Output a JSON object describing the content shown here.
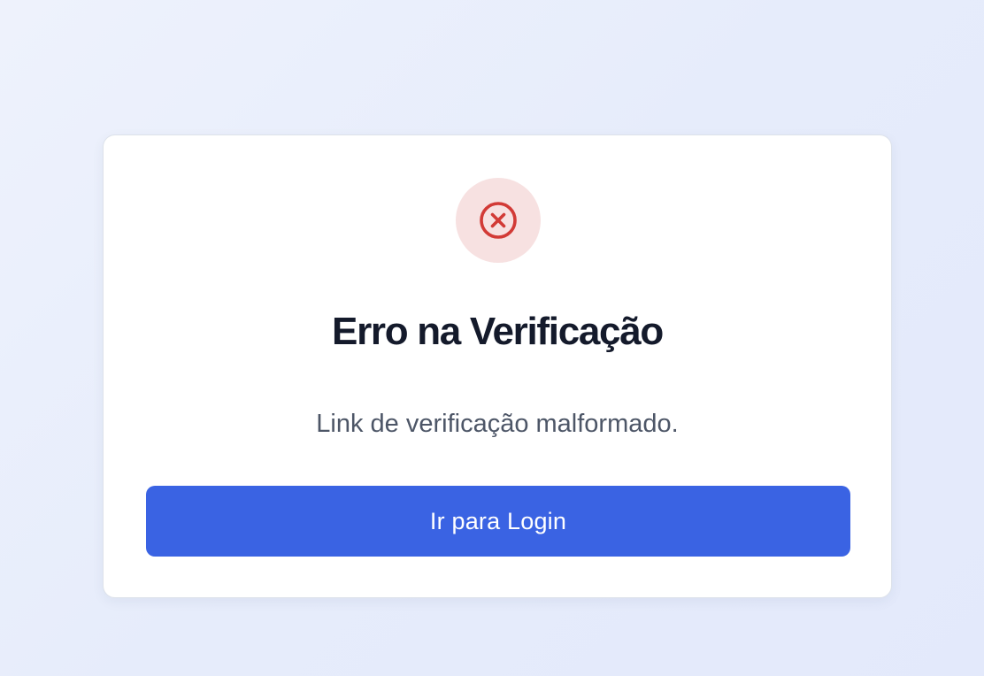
{
  "card": {
    "icon": "x-circle-icon",
    "title": "Erro na Verificação",
    "message": "Link de verificação malformado.",
    "button_label": "Ir para Login"
  },
  "colors": {
    "accent": "#3a63e3",
    "error": "#d23a36",
    "error_bg": "#f7e1e1",
    "title": "#141a2b",
    "message": "#4d5667"
  }
}
